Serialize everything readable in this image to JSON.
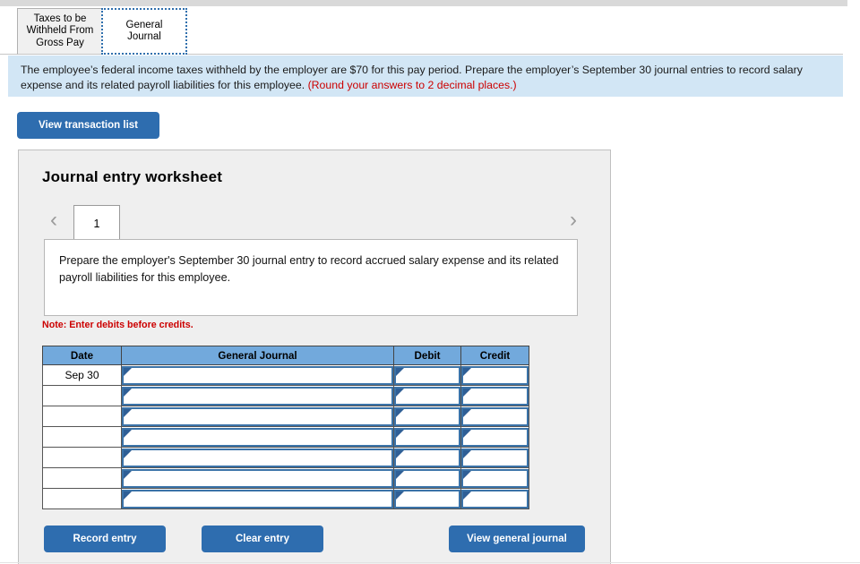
{
  "tabs": [
    {
      "label_line1": "Taxes to be",
      "label_line2": "Withheld From",
      "label_line3": "Gross Pay",
      "active": false
    },
    {
      "label_line1": "General",
      "label_line2": "Journal",
      "active": true
    }
  ],
  "banner": {
    "text": "The employee’s federal income taxes withheld by the employer are $70 for this pay period. Prepare the employer’s September 30 journal entries to record salary expense and its related payroll liabilities for this employee.",
    "round_note": "(Round your answers to 2 decimal places.)"
  },
  "toolbar": {
    "view_transaction_list_label": "View transaction list"
  },
  "worksheet": {
    "title": "Journal entry worksheet",
    "pager": {
      "prev_icon": "chevron-left-icon",
      "next_icon": "chevron-right-icon",
      "pages": [
        "1"
      ],
      "active_page": "1"
    },
    "prompt": "Prepare the employer's September 30 journal entry to record accrued salary expense and its related payroll liabilities for this employee.",
    "debit_note": "Note: Enter debits before credits.",
    "table": {
      "headers": [
        "Date",
        "General Journal",
        "Debit",
        "Credit"
      ],
      "rows": [
        {
          "date": "Sep 30",
          "general_journal": "",
          "debit": "",
          "credit": ""
        },
        {
          "date": "",
          "general_journal": "",
          "debit": "",
          "credit": ""
        },
        {
          "date": "",
          "general_journal": "",
          "debit": "",
          "credit": ""
        },
        {
          "date": "",
          "general_journal": "",
          "debit": "",
          "credit": ""
        },
        {
          "date": "",
          "general_journal": "",
          "debit": "",
          "credit": ""
        },
        {
          "date": "",
          "general_journal": "",
          "debit": "",
          "credit": ""
        },
        {
          "date": "",
          "general_journal": "",
          "debit": "",
          "credit": ""
        }
      ]
    },
    "actions": {
      "record_entry_label": "Record entry",
      "clear_entry_label": "Clear entry",
      "view_general_journal_label": "View general journal"
    }
  },
  "colors": {
    "button_blue": "#2e6daf",
    "table_header_blue": "#72a9dc",
    "banner_blue": "#d2e6f5",
    "note_red": "#cc0000",
    "panel_gray": "#efefef",
    "input_border_blue": "#3b73a8"
  }
}
